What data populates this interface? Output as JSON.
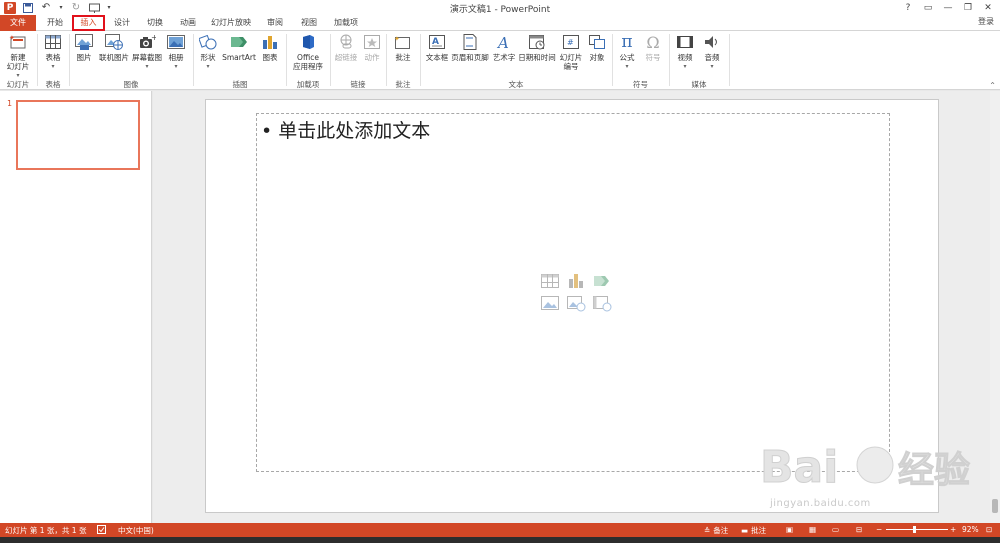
{
  "window": {
    "title": "演示文稿1 - PowerPoint",
    "controls": [
      "?",
      "▭",
      "—",
      "❐",
      "✕"
    ]
  },
  "tabs": [
    {
      "label": "文件",
      "active": false
    },
    {
      "label": "开始",
      "active": false
    },
    {
      "label": "插入",
      "active": true
    },
    {
      "label": "设计",
      "active": false
    },
    {
      "label": "切换",
      "active": false
    },
    {
      "label": "动画",
      "active": false
    },
    {
      "label": "幻灯片放映",
      "active": false
    },
    {
      "label": "审阅",
      "active": false
    },
    {
      "label": "视图",
      "active": false
    },
    {
      "label": "加载项",
      "active": false
    }
  ],
  "login_label": "登录",
  "ribbon": {
    "groups": {
      "slides": {
        "label": "幻灯片",
        "new_slide": "新建",
        "new_slide2": "幻灯片"
      },
      "tables": {
        "label": "表格",
        "table": "表格"
      },
      "images": {
        "label": "图像",
        "picture": "图片",
        "online_picture": "联机图片",
        "screenshot": "屏幕截图",
        "album": "相册"
      },
      "illustrations": {
        "label": "插图",
        "shapes": "形状",
        "smartart": "SmartArt",
        "chart": "图表"
      },
      "addins": {
        "label": "加载项",
        "office": "Office",
        "office2": "应用程序"
      },
      "links": {
        "label": "链接",
        "hyperlink": "超链接",
        "action": "动作"
      },
      "comments": {
        "label": "批注",
        "comment": "批注"
      },
      "text": {
        "label": "文本",
        "textbox": "文本框",
        "header_footer": "页眉和页脚",
        "wordart": "艺术字",
        "datetime": "日期和时间",
        "slide_number": "幻灯片",
        "slide_number2": "编号",
        "object": "对象"
      },
      "symbols": {
        "label": "符号",
        "equation": "公式",
        "symbol": "符号"
      },
      "media": {
        "label": "媒体",
        "video": "视频",
        "audio": "音频"
      }
    }
  },
  "thumbnails": {
    "slide_number": "1"
  },
  "slide": {
    "placeholder_text": "• 单击此处添加文本"
  },
  "statusbar": {
    "slide_info": "幻灯片 第 1 张，共 1 张",
    "language": "中文(中国)",
    "notes": "备注",
    "comments": "批注",
    "zoom_percent": "92%",
    "zoom_level": 0.92
  },
  "watermark": {
    "text": "jingyan.baidu.com"
  },
  "colors": {
    "accent": "#d24726",
    "tab_highlight_border": "#e1111b",
    "thumb_border": "#e9765a"
  }
}
